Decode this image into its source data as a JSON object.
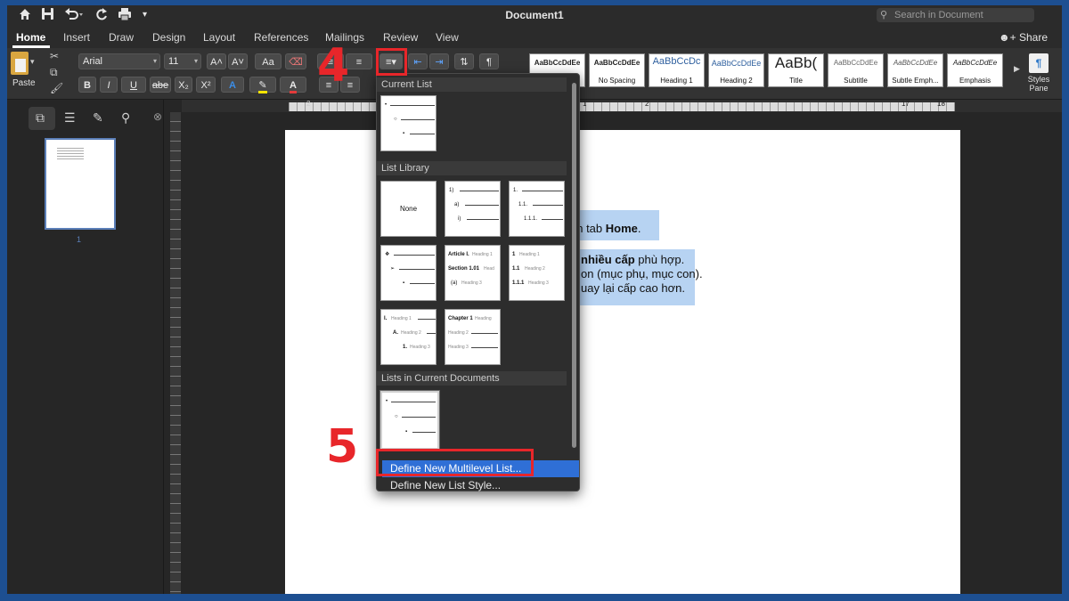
{
  "window": {
    "title": "Document1",
    "search_placeholder": "Search in Document",
    "share_label": "Share"
  },
  "tabs": [
    "Home",
    "Insert",
    "Draw",
    "Design",
    "Layout",
    "References",
    "Mailings",
    "Review",
    "View"
  ],
  "ribbon": {
    "paste_label": "Paste",
    "font_name": "Arial",
    "font_size": "11",
    "bold": "B",
    "italic": "I",
    "underline": "U",
    "strike": "abe",
    "subscript": "X₂",
    "superscript": "X²",
    "grow_font": "A˄",
    "shrink_font": "A˅",
    "change_case": "Aa",
    "text_effects": "A",
    "pilcrow": "¶",
    "styles": [
      {
        "sample": "AaBbCcDdEe",
        "name": ""
      },
      {
        "sample": "AaBbCcDdEe",
        "name": "No Spacing"
      },
      {
        "sample": "AaBbCcDc",
        "name": "Heading 1"
      },
      {
        "sample": "AaBbCcDdEe",
        "name": "Heading 2"
      },
      {
        "sample": "AaBb(",
        "name": "Title"
      },
      {
        "sample": "AaBbCcDdEe",
        "name": "Subtitle"
      },
      {
        "sample": "AaBbCcDdEe",
        "name": "Subtle Emph..."
      },
      {
        "sample": "AaBbCcDdEe",
        "name": "Emphasis"
      }
    ],
    "styles_pane_label": [
      "Styles",
      "Pane"
    ]
  },
  "ruler_numbers": [
    "2",
    "1",
    "1",
    "2",
    "17",
    "18"
  ],
  "thumbnail_page_number": "1",
  "document_lines": [
    {
      "pre": "",
      "bold": "",
      "post": "ọn tab ",
      "bold2": "Home",
      "post2": "."
    },
    {
      "pre": "",
      "bold": "nhiều cấp",
      "post": " phù hợp.",
      "bold2": "",
      "post2": ""
    },
    {
      "pre": "on (mục phụ, mục con).",
      "bold": "",
      "post": "",
      "bold2": "",
      "post2": ""
    },
    {
      "pre": "uay lại cấp cao hơn.",
      "bold": "",
      "post": "",
      "bold2": "",
      "post2": ""
    }
  ],
  "menu": {
    "section_current": "Current List",
    "section_library": "List Library",
    "section_documents": "Lists in Current Documents",
    "none_label": "None",
    "item_define_list": "Define New Multilevel List...",
    "item_define_style": "Define New List Style...",
    "library": {
      "numbered": [
        "1)",
        "a)",
        "i)"
      ],
      "decimal": [
        "1.",
        "1.1.",
        "1.1.1."
      ],
      "symbols": [
        "❖",
        "➢",
        "▪"
      ],
      "article": [
        {
          "mark": "Article I.",
          "text": "Heading 1"
        },
        {
          "mark": "Section 1.01",
          "text": "Head"
        },
        {
          "mark": "(a)",
          "text": "Heading 3"
        }
      ],
      "decimal_headings": [
        {
          "mark": "1",
          "text": "Heading 1"
        },
        {
          "mark": "1.1",
          "text": "Heading 2"
        },
        {
          "mark": "1.1.1",
          "text": "Heading 3"
        }
      ],
      "roman": [
        {
          "mark": "I.",
          "text": "Heading 1"
        },
        {
          "mark": "A.",
          "text": "Heading 2"
        },
        {
          "mark": "1.",
          "text": "Heading 3"
        }
      ],
      "chapter": [
        {
          "mark": "Chapter 1",
          "text": "Heading"
        },
        {
          "mark": "",
          "text": "Heading 2"
        },
        {
          "mark": "",
          "text": "Heading 3"
        }
      ]
    }
  },
  "annotations": {
    "step4": "4",
    "step5": "5"
  },
  "colors": {
    "accent_blue": "#2f6fd6",
    "annotation_red": "#e8262a",
    "selection": "#b7d3f2",
    "border_blue": "#1d4f91"
  }
}
